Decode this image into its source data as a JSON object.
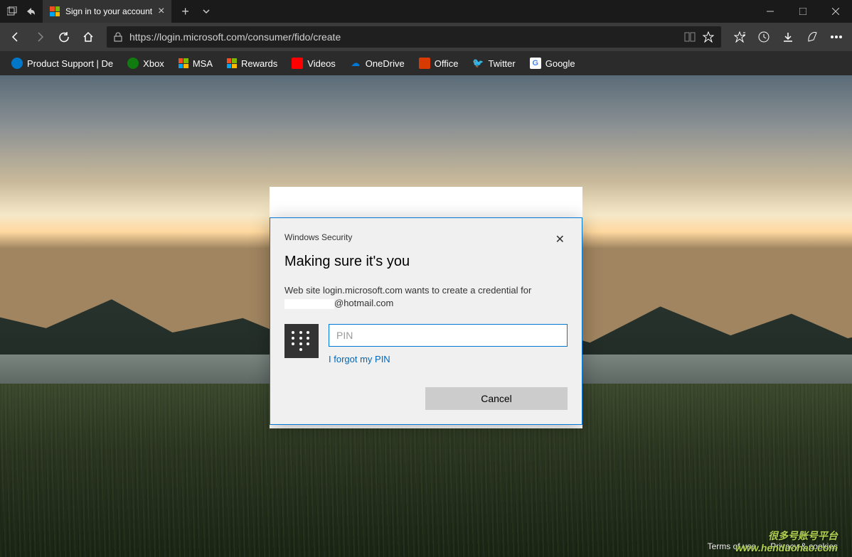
{
  "browser": {
    "tab_title": "Sign in to your account",
    "url": "https://login.microsoft.com/consumer/fido/create"
  },
  "bookmarks": [
    {
      "label": "Product Support | De",
      "color": "#0077c8"
    },
    {
      "label": "Xbox",
      "color": "#107c10"
    },
    {
      "label": "MSA",
      "color": null
    },
    {
      "label": "Rewards",
      "color": null
    },
    {
      "label": "Videos",
      "color": "#ff0000"
    },
    {
      "label": "OneDrive",
      "color": "#0078d4"
    },
    {
      "label": "Office",
      "color": "#d83b01"
    },
    {
      "label": "Twitter",
      "color": "#1da1f2"
    },
    {
      "label": "Google",
      "color": "#ffffff"
    }
  ],
  "dialog": {
    "label": "Windows Security",
    "title": "Making sure it's you",
    "description_line1": "Web site login.microsoft.com wants to create a credential for",
    "description_line2": "@hotmail.com",
    "pin_placeholder": "PIN",
    "forgot_link": "I forgot my PIN",
    "cancel": "Cancel"
  },
  "footer": {
    "terms": "Terms of use",
    "privacy": "Privacy & cookies"
  },
  "watermark": {
    "line1": "很多号账号平台",
    "line2": "www.henduohao.com"
  }
}
